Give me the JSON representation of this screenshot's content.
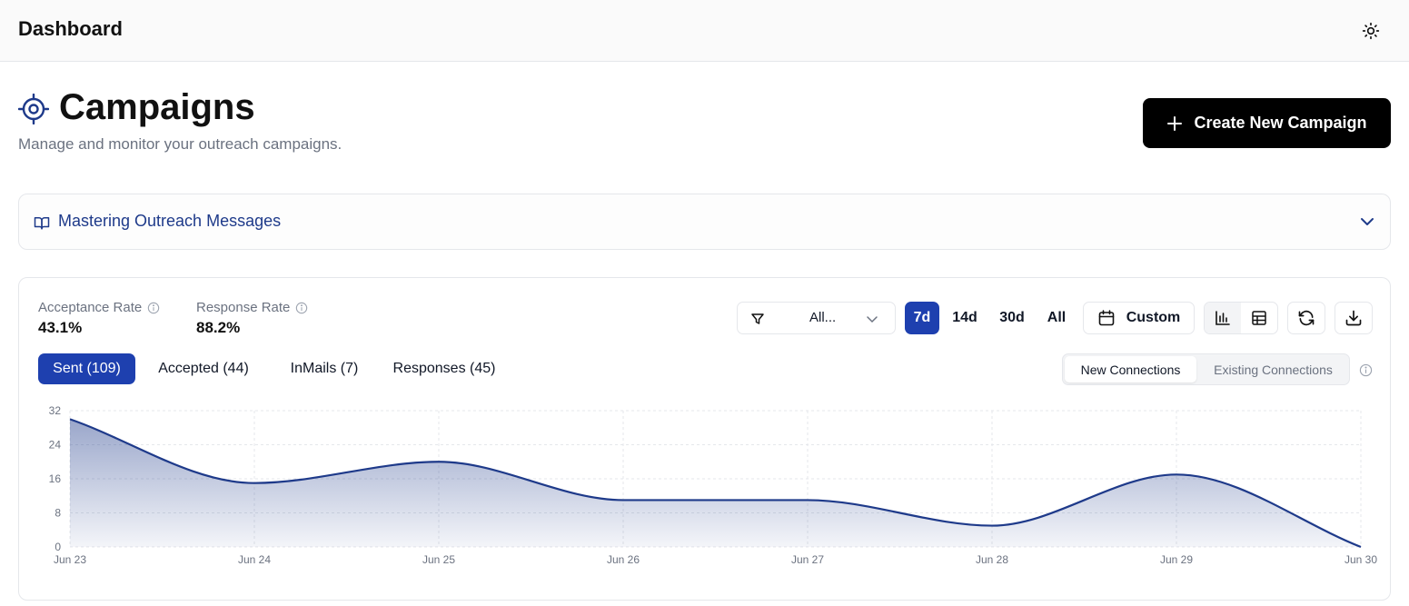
{
  "header": {
    "title": "Dashboard",
    "theme_icon": "sun-icon"
  },
  "page": {
    "icon": "target-icon",
    "title": "Campaigns",
    "subtitle": "Manage and monitor your outreach campaigns.",
    "create_button": {
      "label": "Create New Campaign",
      "icon": "plus-icon"
    }
  },
  "guide": {
    "label": "Mastering Outreach Messages",
    "icon": "book-open-icon"
  },
  "metrics": [
    {
      "label": "Acceptance Rate",
      "value": "43.1%"
    },
    {
      "label": "Response Rate",
      "value": "88.2%"
    }
  ],
  "filters": {
    "campaign_select": "All...",
    "ranges": [
      "7d",
      "14d",
      "30d",
      "All"
    ],
    "active_range": "7d",
    "custom_label": "Custom"
  },
  "tabs": [
    {
      "label": "Sent (109)",
      "active": true
    },
    {
      "label": "Accepted (44)",
      "active": false
    },
    {
      "label": "InMails (7)",
      "active": false
    },
    {
      "label": "Responses (45)",
      "active": false
    }
  ],
  "connection_toggle": {
    "options": [
      "New Connections",
      "Existing Connections"
    ],
    "active": "New Connections"
  },
  "colors": {
    "accent": "#1e40af",
    "line": "#1e3a8a",
    "area_top": "#1e3a8a"
  },
  "chart_data": {
    "type": "area",
    "categories": [
      "Jun 23",
      "Jun 24",
      "Jun 25",
      "Jun 26",
      "Jun 27",
      "Jun 28",
      "Jun 29",
      "Jun 30"
    ],
    "series": [
      {
        "values": [
          30,
          15,
          20,
          11,
          11,
          5,
          17,
          0
        ]
      }
    ],
    "ylim": [
      0,
      32
    ],
    "yticks": [
      0,
      8,
      16,
      24,
      32
    ],
    "grid": true,
    "title": "",
    "xlabel": "",
    "ylabel": ""
  }
}
